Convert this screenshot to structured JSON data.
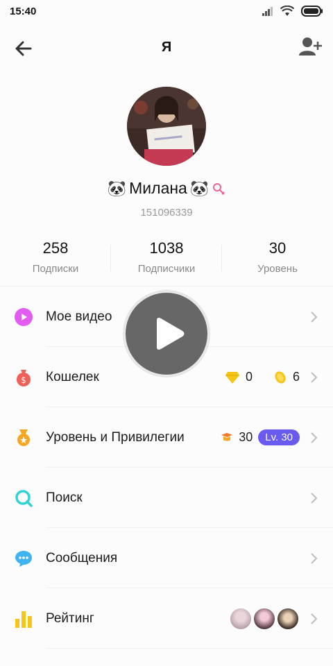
{
  "status": {
    "time": "15:40"
  },
  "header": {
    "title": "Я"
  },
  "profile": {
    "name": "Милана",
    "id": "151096339"
  },
  "stats": [
    {
      "value": "258",
      "label": "Подписки"
    },
    {
      "value": "1038",
      "label": "Подписчики"
    },
    {
      "value": "30",
      "label": "Уровень"
    }
  ],
  "menu": {
    "my_video": "Мое видео",
    "wallet": "Кошелек",
    "wallet_diamonds": "0",
    "wallet_coins": "6",
    "level": "Уровень и Привилегии",
    "level_value": "30",
    "level_badge": "Lv. 30",
    "search": "Поиск",
    "messages": "Сообщения",
    "rating": "Рейтинг"
  },
  "colors": {
    "accent_purple": "#6a5bf0",
    "video_icon": "#e25cf0",
    "wallet_icon": "#f0605a",
    "level_icon": "#f5a623",
    "search_icon": "#2fd3d3",
    "messages_icon": "#3fb4f0",
    "rating_icon": "#f5c518"
  }
}
